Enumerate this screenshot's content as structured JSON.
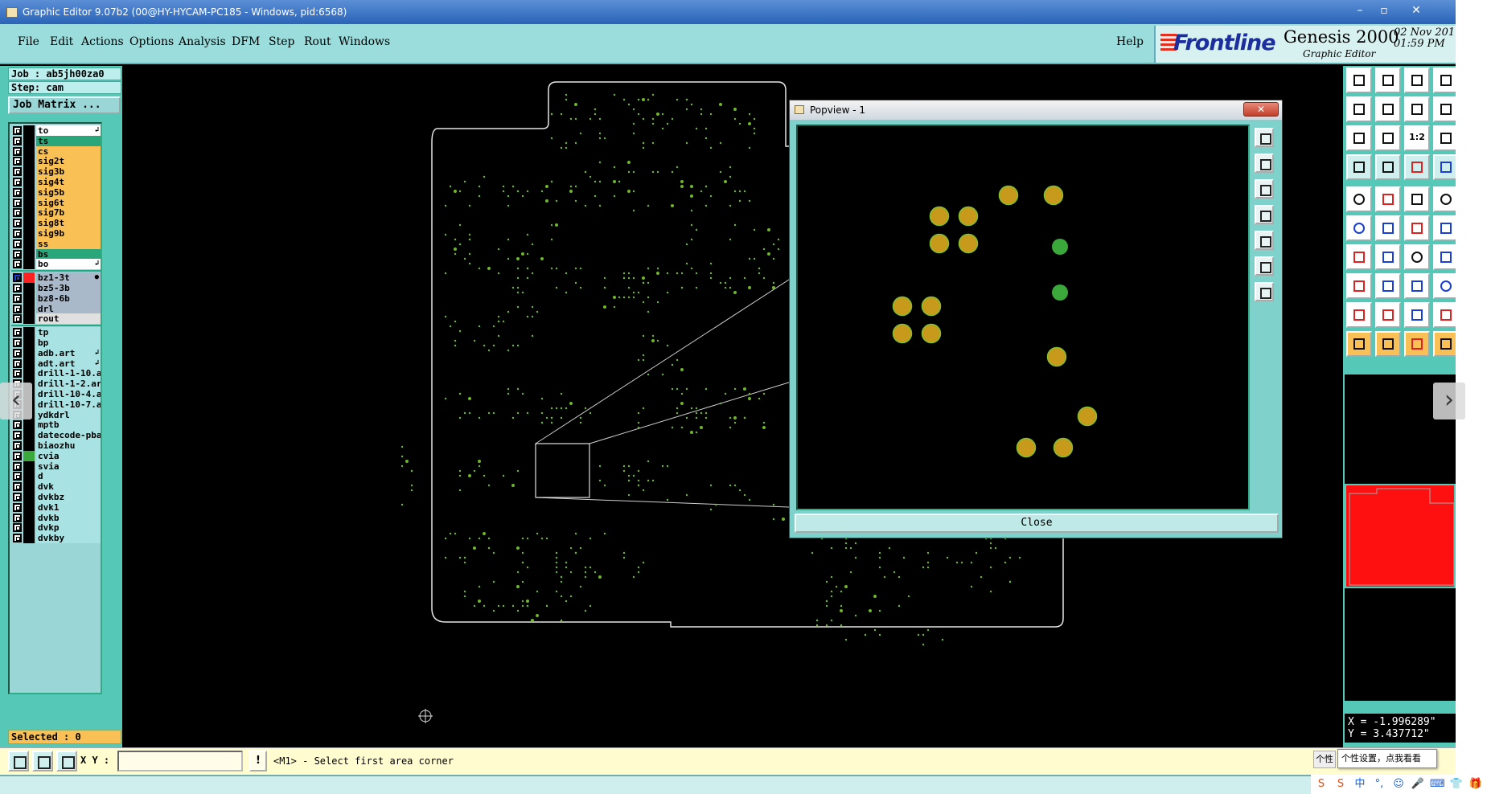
{
  "window": {
    "title": "Graphic Editor 9.07b2 (00@HY-HYCAM-PC185 - Windows, pid:6568)",
    "controls": [
      "–",
      "▫",
      "✕"
    ]
  },
  "menu": {
    "items": [
      "File",
      "Edit",
      "Actions",
      "Options",
      "Analysis",
      "DFM",
      "Step",
      "Rout",
      "Windows"
    ],
    "help": "Help"
  },
  "brand": {
    "logo": "Frontline",
    "product": "Genesis 2000",
    "subtitle": "Graphic Editor",
    "date": "02 Nov 201",
    "time": "01:59 PM"
  },
  "left": {
    "job": "Job : ab5jh00za0",
    "step": "Step: cam",
    "job_matrix": "Job Matrix ...",
    "selected": "Selected : 0",
    "layers": [
      {
        "name": "to",
        "bg": "#ffffff",
        "mark": "↲"
      },
      {
        "name": "ts",
        "bg": "#2aa77a"
      },
      {
        "name": "cs",
        "bg": "#f8c055"
      },
      {
        "name": "sig2t",
        "bg": "#f8c055"
      },
      {
        "name": "sig3b",
        "bg": "#f8c055"
      },
      {
        "name": "sig4t",
        "bg": "#f8c055"
      },
      {
        "name": "sig5b",
        "bg": "#f8c055"
      },
      {
        "name": "sig6t",
        "bg": "#f8c055"
      },
      {
        "name": "sig7b",
        "bg": "#f8c055"
      },
      {
        "name": "sig8t",
        "bg": "#f8c055"
      },
      {
        "name": "sig9b",
        "bg": "#f8c055"
      },
      {
        "name": "ss",
        "bg": "#f8c055"
      },
      {
        "name": "bs",
        "bg": "#2aa77a"
      },
      {
        "name": "bo",
        "bg": "#ffffff",
        "mark": "↲"
      },
      {
        "sep": true
      },
      {
        "name": "bz1-3t",
        "bg": "#a9b9c9",
        "swatch": "#ff2020",
        "checked": true,
        "mark": "●"
      },
      {
        "name": "bz5-3b",
        "bg": "#a9b9c9"
      },
      {
        "name": "bz8-6b",
        "bg": "#a9b9c9"
      },
      {
        "name": "drl",
        "bg": "#a9b9c9"
      },
      {
        "name": "rout",
        "bg": "#e0e0e0"
      },
      {
        "sep": true
      },
      {
        "name": "tp",
        "bg": "#a8e2e2"
      },
      {
        "name": "bp",
        "bg": "#a8e2e2"
      },
      {
        "name": "adb.art",
        "bg": "#a8e2e2",
        "mark": "↲"
      },
      {
        "name": "adt.art",
        "bg": "#a8e2e2",
        "mark": "↲"
      },
      {
        "name": "drill-1-10.a",
        "bg": "#a8e2e2"
      },
      {
        "name": "drill-1-2.ar",
        "bg": "#a8e2e2"
      },
      {
        "name": "drill-10-4.a",
        "bg": "#a8e2e2"
      },
      {
        "name": "drill-10-7.a",
        "bg": "#a8e2e2"
      },
      {
        "name": "ydkdrl",
        "bg": "#a8e2e2"
      },
      {
        "name": "mptb",
        "bg": "#a8e2e2"
      },
      {
        "name": "datecode-pba",
        "bg": "#a8e2e2"
      },
      {
        "name": "biaozhu",
        "bg": "#a8e2e2"
      },
      {
        "name": "cvia",
        "bg": "#a8e2e2",
        "swatch": "#3aa83a"
      },
      {
        "name": "svia",
        "bg": "#a8e2e2"
      },
      {
        "name": "d",
        "bg": "#a8e2e2"
      },
      {
        "name": "dvk",
        "bg": "#a8e2e2"
      },
      {
        "name": "dvkbz",
        "bg": "#a8e2e2"
      },
      {
        "name": "dvk1",
        "bg": "#a8e2e2"
      },
      {
        "name": "dvkb",
        "bg": "#a8e2e2"
      },
      {
        "name": "dvkp",
        "bg": "#a8e2e2"
      },
      {
        "name": "dvkby",
        "bg": "#a8e2e2"
      }
    ]
  },
  "popview": {
    "title": "Popview - 1",
    "close_x": "✕",
    "close_button": "Close"
  },
  "right": {
    "tool_labels": {
      "ratio": "1:2"
    },
    "coords": "X = -1.996289\"\nY = 3.437712\""
  },
  "bottom": {
    "xy_label": "X Y :",
    "xy_value": "",
    "excl": "!",
    "prompt": "<M1> - Select first area corner"
  },
  "overlay": {
    "nav_left": "‹",
    "nav_right": "›",
    "tip_small": "个性",
    "tip": "个性设置，点我看看",
    "tray": [
      "S",
      "S",
      "中",
      "°,",
      "☺",
      "🎤",
      "⌨",
      "👕",
      "🎁"
    ]
  },
  "colors": {
    "copper": "#c89a1c",
    "copper_edge": "#7fbf30",
    "via_green": "#3aa83a",
    "dot_green": "#6fb82a"
  }
}
